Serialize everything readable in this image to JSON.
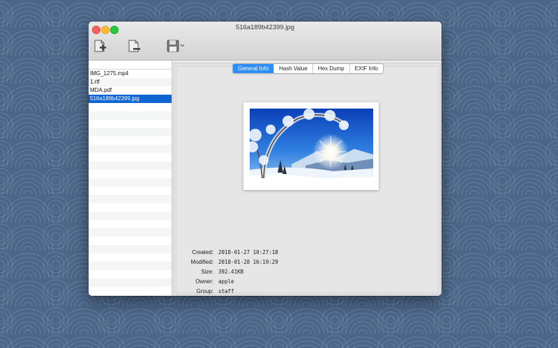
{
  "window": {
    "title": "516a189b42399.jpg"
  },
  "toolbar": {
    "add_icon": "add-file-icon",
    "remove_icon": "remove-file-icon",
    "save_icon": "save-disk-icon"
  },
  "sidebar": {
    "files": [
      {
        "name": "IMG_1275.mp4",
        "selected": false
      },
      {
        "name": "1.rtf",
        "selected": false
      },
      {
        "name": "MDA.pdf",
        "selected": false
      },
      {
        "name": "516a189b42399.jpg",
        "selected": true
      }
    ]
  },
  "tabs": [
    {
      "label": "General Info",
      "active": true
    },
    {
      "label": "Hash Value",
      "active": false
    },
    {
      "label": "Hex Dump",
      "active": false
    },
    {
      "label": "EXIF Info",
      "active": false
    }
  ],
  "info": {
    "created_label": "Created:",
    "created_value": "2018-01-27 10:27:18",
    "modified_label": "Modified:",
    "modified_value": "2018-01-28 16:19:29",
    "size_label": "Size:",
    "size_value": "392.41KB",
    "owner_label": "Owner:",
    "owner_value": "apple",
    "group_label": "Group:",
    "group_value": "staff"
  },
  "colors": {
    "selection": "#0e64d0",
    "active_tab": "#2d8ef7",
    "wallpaper": "#4b6688"
  }
}
